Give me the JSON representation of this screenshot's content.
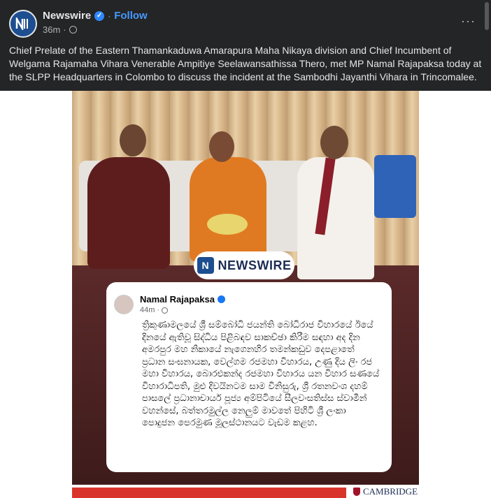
{
  "post": {
    "page_name": "Newswire",
    "separator": "·",
    "follow_label": "Follow",
    "time": "36m",
    "time_separator": "·",
    "text": "Chief Prelate of the Eastern Thamankaduwa Amarapura Maha Nikaya division and Chief Incumbent of Welgama Rajamaha Vihara Venerable Ampitiye Seelawansathissa Thero, met MP Namal Rajapaksa today at the SLPP Headquarters in Colombo to discuss the incident at the Sambodhi Jayanthi Vihara in Trincomalee.",
    "more_label": "···"
  },
  "image": {
    "brand": {
      "logo_letter": "N",
      "name": "NEWSWIRE"
    },
    "card": {
      "name": "Namal Rajapaksa",
      "time": "44m",
      "time_separator": "·",
      "body": "ත්‍රිකුණාමලයේ ශ්‍රී සම්බෝධි ජයන්ති බෝධිරාජ විහාරයේ ඊයේ දිනයේ ඇතිවූ සිද්ධිය පිළිබඳව සාකච්ඡා කිරීම සඳහා අද දින අමරපුර මහ නිකායේ නැගෙනහිර තමන්කඩුව දෙපළාතේ ප්‍රධාන සංඝනායක, වෙල්ගම රජමහා විහාරය, උණු දිය ලිං රජ මහා විහාරය, බොරළුකන්ද රජමහා විහාරය යන විහාර සණයේ විහාරාධිපති, මුළු දිවයිනටම සාම විනිසුරු, ශ්‍රී රතනවංශ දහම් පාසලේ ප්‍රධානාචාර්ය පූජ්‍ය අම්පිටියේ සීලවංසතිස්ස ස්වාමීන් වහන්සේ, බත්තරමුල්ල නෙලුම් මාවතේ පිහිටි ශ්‍රී ලංකා පොදුජන පෙරමුණ මූලස්ථානයට වැඩම කළහ."
    },
    "footer": {
      "brand": "CAMBRIDGE"
    }
  },
  "colors": {
    "background": "#242526",
    "text": "#e4e6eb",
    "follow": "#4599ff",
    "verified": "#2d88ff"
  }
}
